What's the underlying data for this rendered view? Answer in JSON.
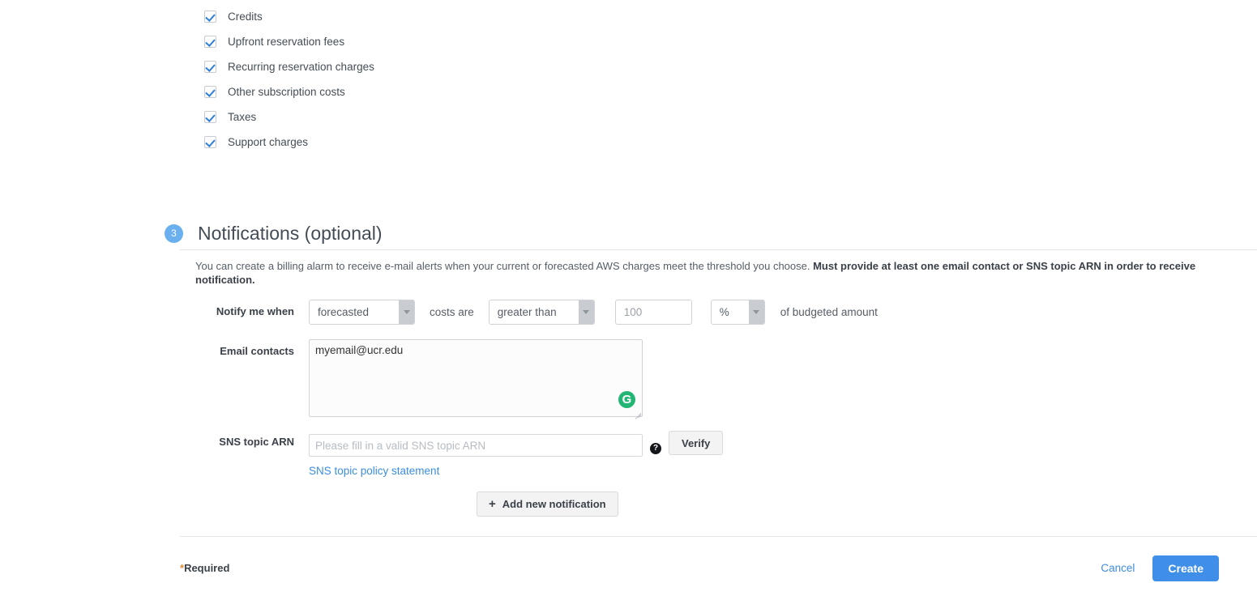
{
  "cost_types": {
    "items": [
      {
        "label": "Credits",
        "checked": true
      },
      {
        "label": "Upfront reservation fees",
        "checked": true
      },
      {
        "label": "Recurring reservation charges",
        "checked": true
      },
      {
        "label": "Other subscription costs",
        "checked": true
      },
      {
        "label": "Taxes",
        "checked": true
      },
      {
        "label": "Support charges",
        "checked": true
      }
    ]
  },
  "notifications": {
    "step_number": "3",
    "title": "Notifications (optional)",
    "description_plain": "You can create a billing alarm to receive e-mail alerts when your current or forecasted AWS charges meet the threshold you choose. ",
    "description_bold": "Must provide at least one email contact or SNS topic ARN in order to receive notification.",
    "notify_row": {
      "label": "Notify me when",
      "trigger_type_value": "forecasted",
      "middle_text": "costs are",
      "comparator_value": "greater than",
      "threshold_value": "100",
      "unit_value": "%",
      "trailing_text": "of budgeted amount"
    },
    "email_contacts": {
      "label": "Email contacts",
      "value": "myemail@ucr.edu",
      "grammarly_badge": "G"
    },
    "sns": {
      "label": "SNS topic ARN",
      "placeholder": "Please fill in a valid SNS topic ARN",
      "value": "",
      "help_glyph": "?",
      "verify_label": "Verify",
      "policy_link_label": "SNS topic policy statement"
    },
    "add_notification": {
      "plus_glyph": "+",
      "label": "Add new notification"
    }
  },
  "footer": {
    "required_star": "*",
    "required_label": "Required",
    "cancel_label": "Cancel",
    "create_label": "Create"
  },
  "colors": {
    "accent_blue": "#3f8ee8",
    "badge_blue": "#6ab0ef",
    "link_blue": "#3b8ede",
    "checkbox_check": "#2f7ed8",
    "grammarly_green": "#22b573",
    "required_orange": "#e08a3c"
  }
}
